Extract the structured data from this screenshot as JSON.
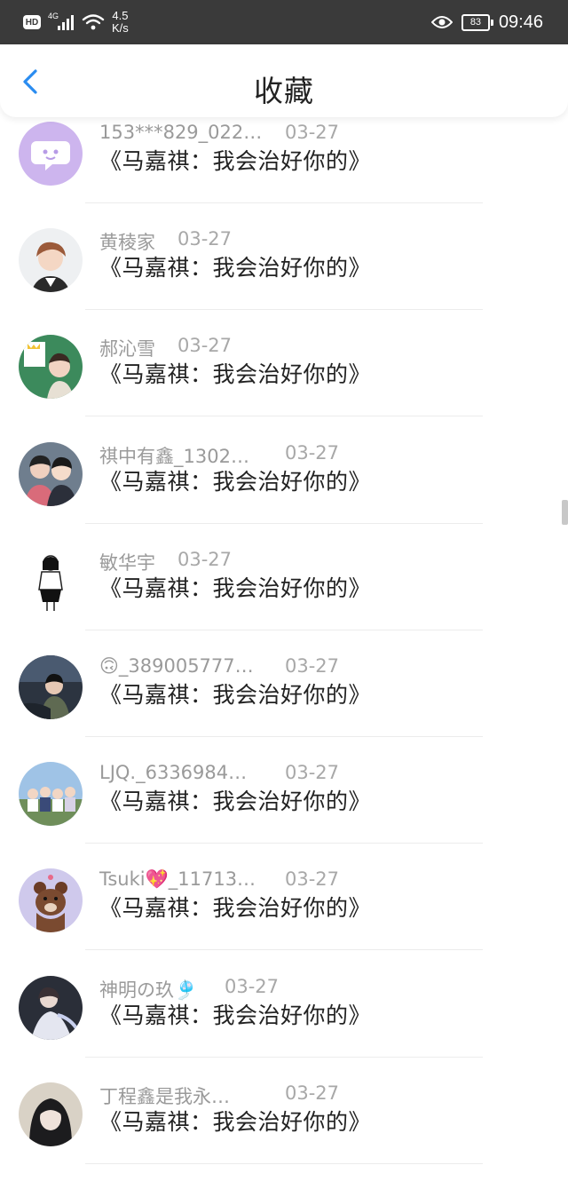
{
  "status_bar": {
    "hd": "HD",
    "network": "4G",
    "speed_value": "4.5",
    "speed_unit": "K/s",
    "battery": "83",
    "time": "09:46",
    "icons": [
      "hd-icon",
      "signal-icon",
      "wifi-icon",
      "eye-icon",
      "battery-icon"
    ]
  },
  "header": {
    "title": "收藏",
    "back_icon": "chevron-left-icon",
    "accent_color": "#2a8cf0"
  },
  "items": [
    {
      "user": "153***829_022…",
      "date": "03-27",
      "title": "《马嘉祺：我会治好你的》"
    },
    {
      "user": "黄稜家",
      "date": "03-27",
      "title": "《马嘉祺：我会治好你的》"
    },
    {
      "user": "郝沁雪",
      "date": "03-27",
      "title": "《马嘉祺：我会治好你的》"
    },
    {
      "user": "祺中有鑫_1302…",
      "date": "03-27",
      "title": "《马嘉祺：我会治好你的》"
    },
    {
      "user": "敏华宇",
      "date": "03-27",
      "title": "《马嘉祺：我会治好你的》"
    },
    {
      "user": "🙃_389005777…",
      "date": "03-27",
      "title": "《马嘉祺：我会治好你的》"
    },
    {
      "user": "LJQ._6336984…",
      "date": "03-27",
      "title": "《马嘉祺：我会治好你的》"
    },
    {
      "user": "Tsuki💖_11713…",
      "date": "03-27",
      "title": "《马嘉祺：我会治好你的》"
    },
    {
      "user": "神明の玖🎐",
      "date": "03-27",
      "title": "《马嘉祺：我会治好你的》"
    },
    {
      "user": "丁程鑫是我永…",
      "date": "03-27",
      "title": "《马嘉祺：我会治好你的》"
    }
  ]
}
